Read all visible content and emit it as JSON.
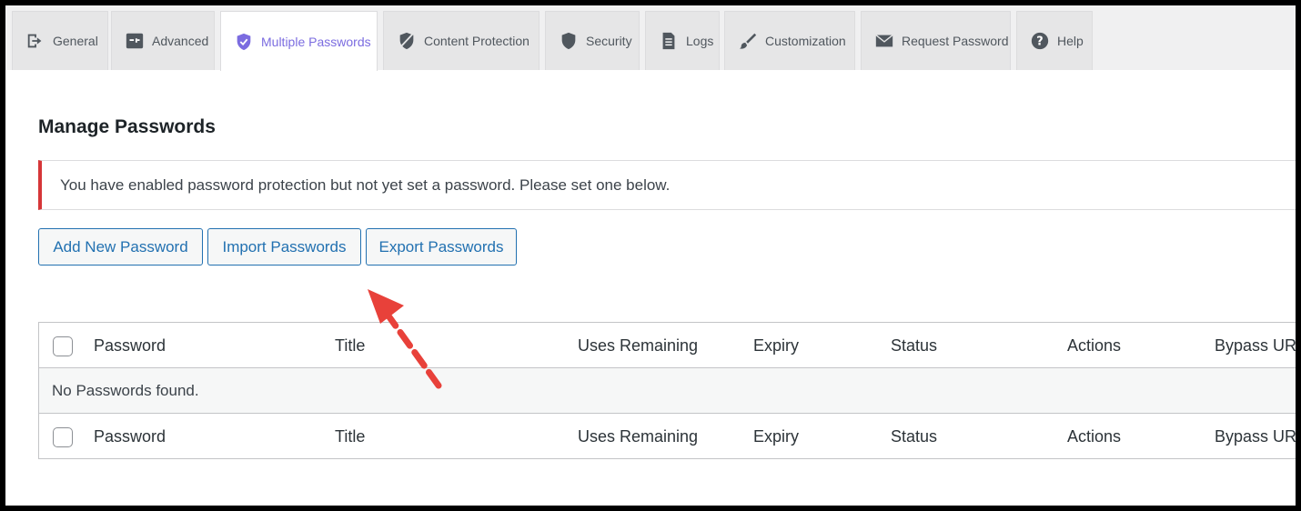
{
  "tabs": [
    {
      "label": "General",
      "icon": "exit-icon"
    },
    {
      "label": "Advanced",
      "icon": "sliders-icon"
    },
    {
      "label": "Multiple Passwords",
      "icon": "shield-icon",
      "active": true
    },
    {
      "label": "Content Protection",
      "icon": "shield-slash-icon"
    },
    {
      "label": "Security",
      "icon": "shield-icon"
    },
    {
      "label": "Logs",
      "icon": "document-icon"
    },
    {
      "label": "Customization",
      "icon": "brush-icon"
    },
    {
      "label": "Request Password",
      "icon": "envelope-icon"
    },
    {
      "label": "Help",
      "icon": "help-icon"
    }
  ],
  "page": {
    "title": "Manage Passwords",
    "notice": "You have enabled password protection but not yet set a password. Please set one below."
  },
  "buttons": {
    "add": "Add New Password",
    "import": "Import Passwords",
    "export": "Export Passwords"
  },
  "table": {
    "columns": [
      "Password",
      "Title",
      "Uses Remaining",
      "Expiry",
      "Status",
      "Actions",
      "Bypass URL"
    ],
    "empty_message": "No Passwords found."
  },
  "colors": {
    "accent": "#7b6ce0",
    "link": "#2271b1",
    "notice_error": "#d63638",
    "annotation_arrow": "#e8413a"
  }
}
